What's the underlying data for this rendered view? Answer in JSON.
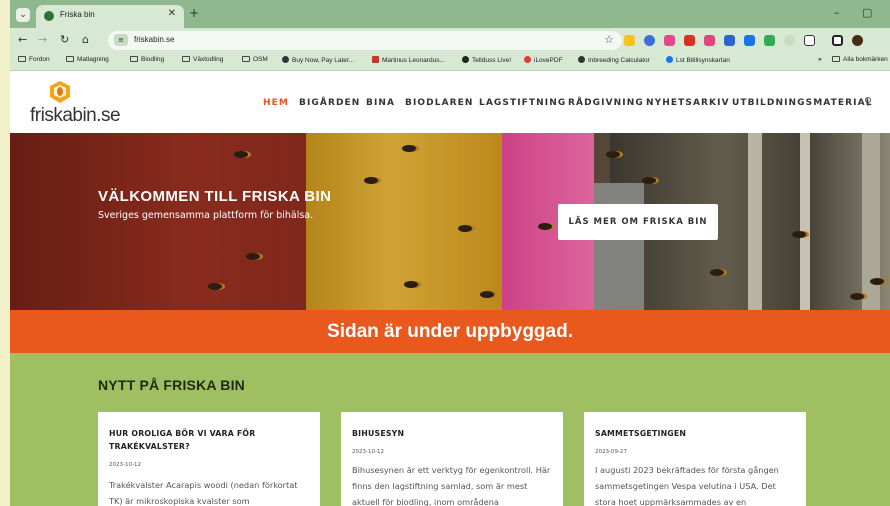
{
  "browser": {
    "tab_title": "Friska bin",
    "tab_close": "✕",
    "new_tab": "+",
    "url": "friskabin.se",
    "window_controls": {
      "minimize": "–",
      "restore": "▢"
    },
    "bookmarks": [
      {
        "label": "Fordon",
        "icon": "folder-icon"
      },
      {
        "label": "Matlagning",
        "icon": "folder-icon"
      },
      {
        "label": "Biodling",
        "icon": "folder-icon"
      },
      {
        "label": "Växtodling",
        "icon": "folder-icon"
      },
      {
        "label": "OSM",
        "icon": "folder-icon"
      },
      {
        "label": "Buy Now, Pay Later...",
        "icon": "site-icon"
      },
      {
        "label": "Martinus Leonardus...",
        "icon": "site-icon"
      },
      {
        "label": "Tellduss Live!",
        "icon": "site-icon"
      },
      {
        "label": "iLovePDF",
        "icon": "site-icon"
      },
      {
        "label": "Inbreeding Calculator",
        "icon": "site-icon"
      },
      {
        "label": "Lst Bitillsynskartan",
        "icon": "site-icon"
      }
    ],
    "bookmarks_more": "»",
    "all_bookmarks": "Alla bokmärken"
  },
  "site": {
    "logo_text": "friskabin.se",
    "nav": [
      "HEM",
      "BIGÅRDEN",
      "BINA",
      "BIODLAREN",
      "LAGSTIFTNING",
      "RÅDGIVNING",
      "NYHETSARKIV",
      "UTBILDNINGSMATERIAL"
    ],
    "nav_active": "HEM",
    "accent_color": "#e8561b"
  },
  "hero": {
    "title": "VÄLKOMMEN TILL FRISKA BIN",
    "subtitle": "Sveriges gemensamma plattform för bihälsa.",
    "button": "LÄS MER OM FRISKA BIN"
  },
  "banner": {
    "text": "Sidan är under uppbyggad."
  },
  "news": {
    "heading": "NYTT PÅ FRISKA BIN",
    "cards": [
      {
        "title": "HUR OROLIGA BÖR VI VARA FÖR TRAKÉKVALSTER?",
        "date": "2023-10-12",
        "excerpt": "Trakékvalster Acarapis woodi (nedan förkortat TK) är mikroskopiska kvalster som"
      },
      {
        "title": "BIHUSESYN",
        "date": "2023-10-12",
        "excerpt": "Bihusesynen är ett verktyg för egenkontroll. Här finns den lagstiftning samlad, som är mest aktuell för biodling, inom områdena"
      },
      {
        "title": "SAMMETSGETINGEN",
        "date": "2023-09-27",
        "excerpt": "I augusti 2023 bekräftades för första gången sammetsgetingen Vespa velutina i USA. Det stora hoet uppmärksammades av en"
      }
    ]
  }
}
